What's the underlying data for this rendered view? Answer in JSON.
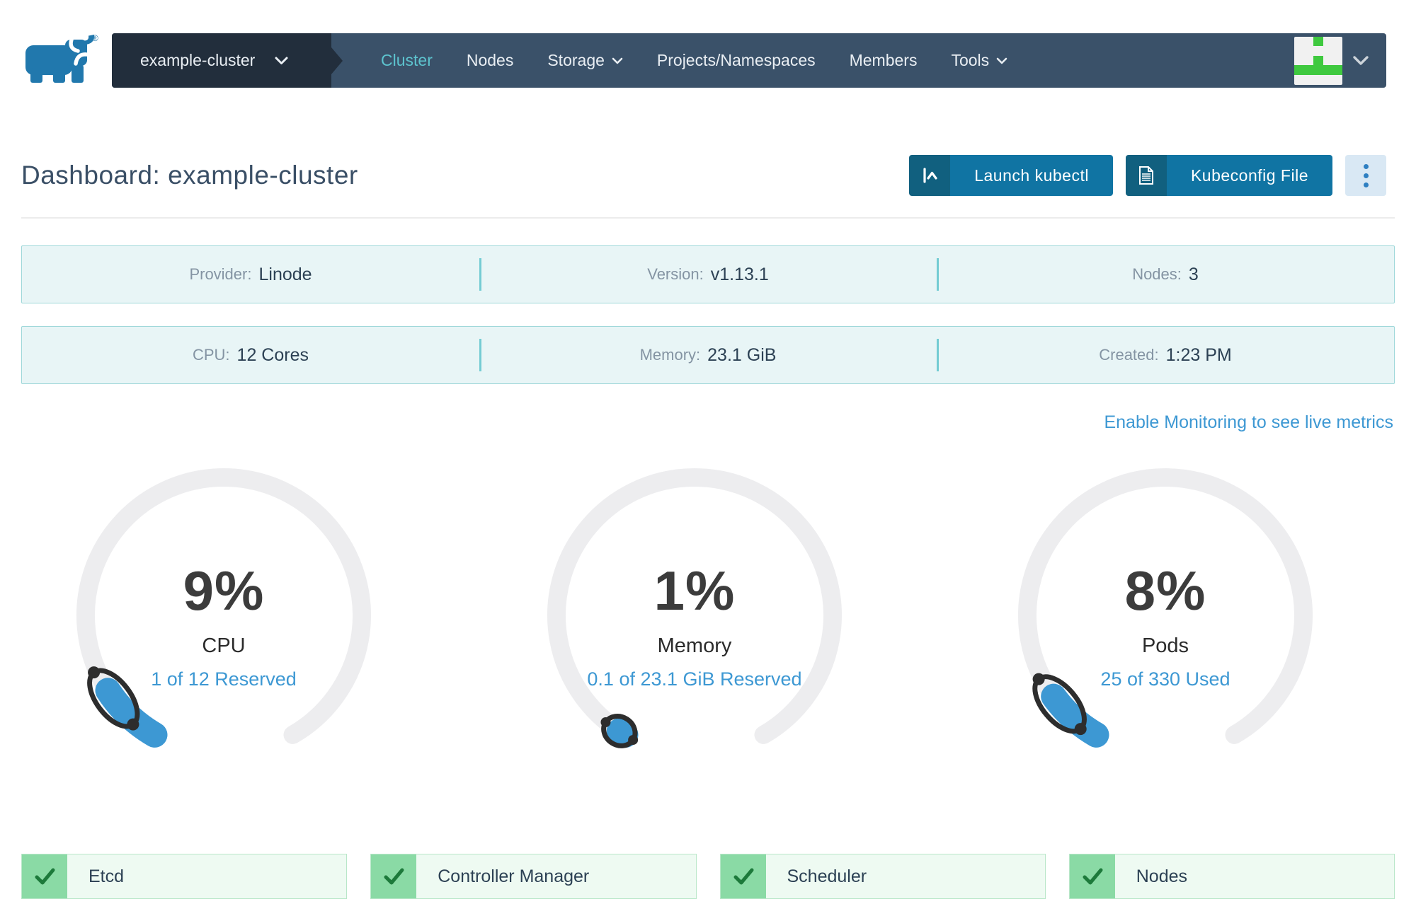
{
  "nav": {
    "cluster_selector_label": "example-cluster",
    "items": [
      {
        "label": "Cluster",
        "active": true,
        "has_dropdown": false
      },
      {
        "label": "Nodes",
        "active": false,
        "has_dropdown": false
      },
      {
        "label": "Storage",
        "active": false,
        "has_dropdown": true
      },
      {
        "label": "Projects/Namespaces",
        "active": false,
        "has_dropdown": false
      },
      {
        "label": "Members",
        "active": false,
        "has_dropdown": false
      },
      {
        "label": "Tools",
        "active": false,
        "has_dropdown": true
      }
    ]
  },
  "header": {
    "title": "Dashboard: example-cluster",
    "buttons": {
      "launch_kubectl": "Launch kubectl",
      "kubeconfig": "Kubeconfig File"
    }
  },
  "info_rows": [
    {
      "cells": [
        {
          "label": "Provider:",
          "value": "Linode"
        },
        {
          "label": "Version:",
          "value": "v1.13.1"
        },
        {
          "label": "Nodes:",
          "value": "3"
        }
      ]
    },
    {
      "cells": [
        {
          "label": "CPU:",
          "value": "12 Cores"
        },
        {
          "label": "Memory:",
          "value": "23.1 GiB"
        },
        {
          "label": "Created:",
          "value": "1:23 PM"
        }
      ]
    }
  ],
  "monitoring_link": {
    "label": "Enable Monitoring to see live metrics"
  },
  "gauges": [
    {
      "percent": 9,
      "percent_label": "9%",
      "label": "CPU",
      "detail": "1 of 12 Reserved"
    },
    {
      "percent": 1,
      "percent_label": "1%",
      "label": "Memory",
      "detail": "0.1 of 23.1 GiB Reserved"
    },
    {
      "percent": 8,
      "percent_label": "8%",
      "label": "Pods",
      "detail": "25 of 330 Used"
    }
  ],
  "statuses": [
    {
      "label": "Etcd",
      "state": "healthy"
    },
    {
      "label": "Controller Manager",
      "state": "healthy"
    },
    {
      "label": "Scheduler",
      "state": "healthy"
    },
    {
      "label": "Nodes",
      "state": "healthy"
    }
  ],
  "icons": {
    "brand": "rancher-bull-logo",
    "cluster_selector": "chevron-down-icon",
    "nav_dropdown": "chevron-down-icon",
    "launch_kubectl": "terminal-prompt-icon",
    "kubeconfig": "document-icon",
    "more_actions": "vertical-ellipsis-icon",
    "user_menu": "chevron-down-icon",
    "status": "checkmark-icon"
  },
  "colors": {
    "navbar_bg": "#3a5169",
    "cluster_selector_bg": "#222e3c",
    "nav_active": "#5dc4cf",
    "nav_text": "#e9eef3",
    "brand_blue": "#2178ad",
    "primary_button": "#1074a3",
    "primary_button_dark": "#11607f",
    "more_button_bg": "#d9e8f4",
    "more_button_dots": "#2e7fc1",
    "title_text": "#3a4f66",
    "link_blue": "#3d98d3",
    "info_bg": "#e8f5f6",
    "info_border": "#9fd8da",
    "info_divider": "#74ccd3",
    "info_label": "#8494a3",
    "info_value": "#2c4154",
    "gauge_track": "#ededef",
    "gauge_fill": "#3d98d3",
    "gauge_marker": "#2d2d2d",
    "gauge_percent_text": "#3c3c3c",
    "status_bg": "#eefaf2",
    "status_border": "#b9e7c9",
    "status_green": "#8adaa5",
    "status_check": "#1d7a3b",
    "avatar_green": "#3fc93f"
  }
}
